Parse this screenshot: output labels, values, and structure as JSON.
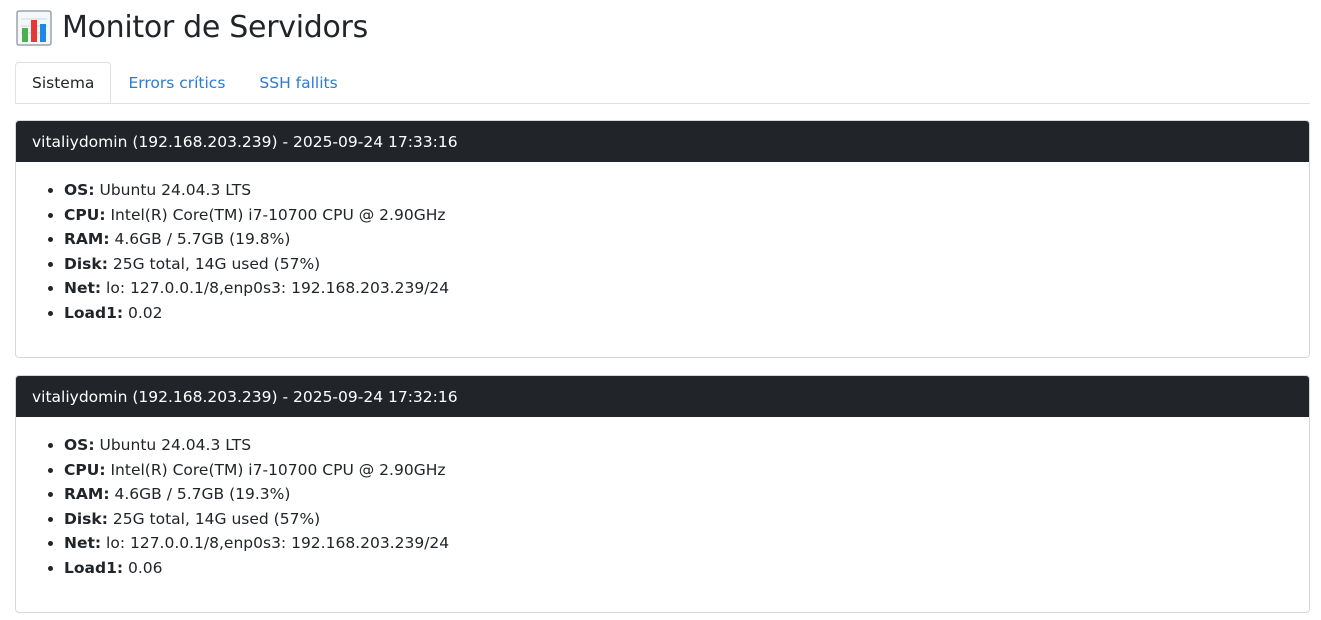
{
  "page": {
    "title": "Monitor de Servidors",
    "title_icon": "bar-chart-icon"
  },
  "tabs": [
    {
      "label": "Sistema",
      "active": true
    },
    {
      "label": "Errors crítics",
      "active": false
    },
    {
      "label": "SSH fallits",
      "active": false
    }
  ],
  "colors": {
    "header_bg": "#212529",
    "link": "#2a7bd5",
    "border": "#dee2e6"
  },
  "reports": [
    {
      "header": "vitaliydomin (192.168.203.239) - 2025-09-24 17:33:16",
      "items": [
        {
          "key": "OS:",
          "value": "Ubuntu 24.04.3 LTS"
        },
        {
          "key": "CPU:",
          "value": "Intel(R) Core(TM) i7-10700 CPU @ 2.90GHz"
        },
        {
          "key": "RAM:",
          "value": "4.6GB / 5.7GB (19.8%)"
        },
        {
          "key": "Disk:",
          "value": "25G total, 14G used (57%)"
        },
        {
          "key": "Net:",
          "value": "lo: 127.0.0.1/8,enp0s3: 192.168.203.239/24"
        },
        {
          "key": "Load1:",
          "value": "0.02"
        }
      ]
    },
    {
      "header": "vitaliydomin (192.168.203.239) - 2025-09-24 17:32:16",
      "items": [
        {
          "key": "OS:",
          "value": "Ubuntu 24.04.3 LTS"
        },
        {
          "key": "CPU:",
          "value": "Intel(R) Core(TM) i7-10700 CPU @ 2.90GHz"
        },
        {
          "key": "RAM:",
          "value": "4.6GB / 5.7GB (19.3%)"
        },
        {
          "key": "Disk:",
          "value": "25G total, 14G used (57%)"
        },
        {
          "key": "Net:",
          "value": "lo: 127.0.0.1/8,enp0s3: 192.168.203.239/24"
        },
        {
          "key": "Load1:",
          "value": "0.06"
        }
      ]
    }
  ]
}
